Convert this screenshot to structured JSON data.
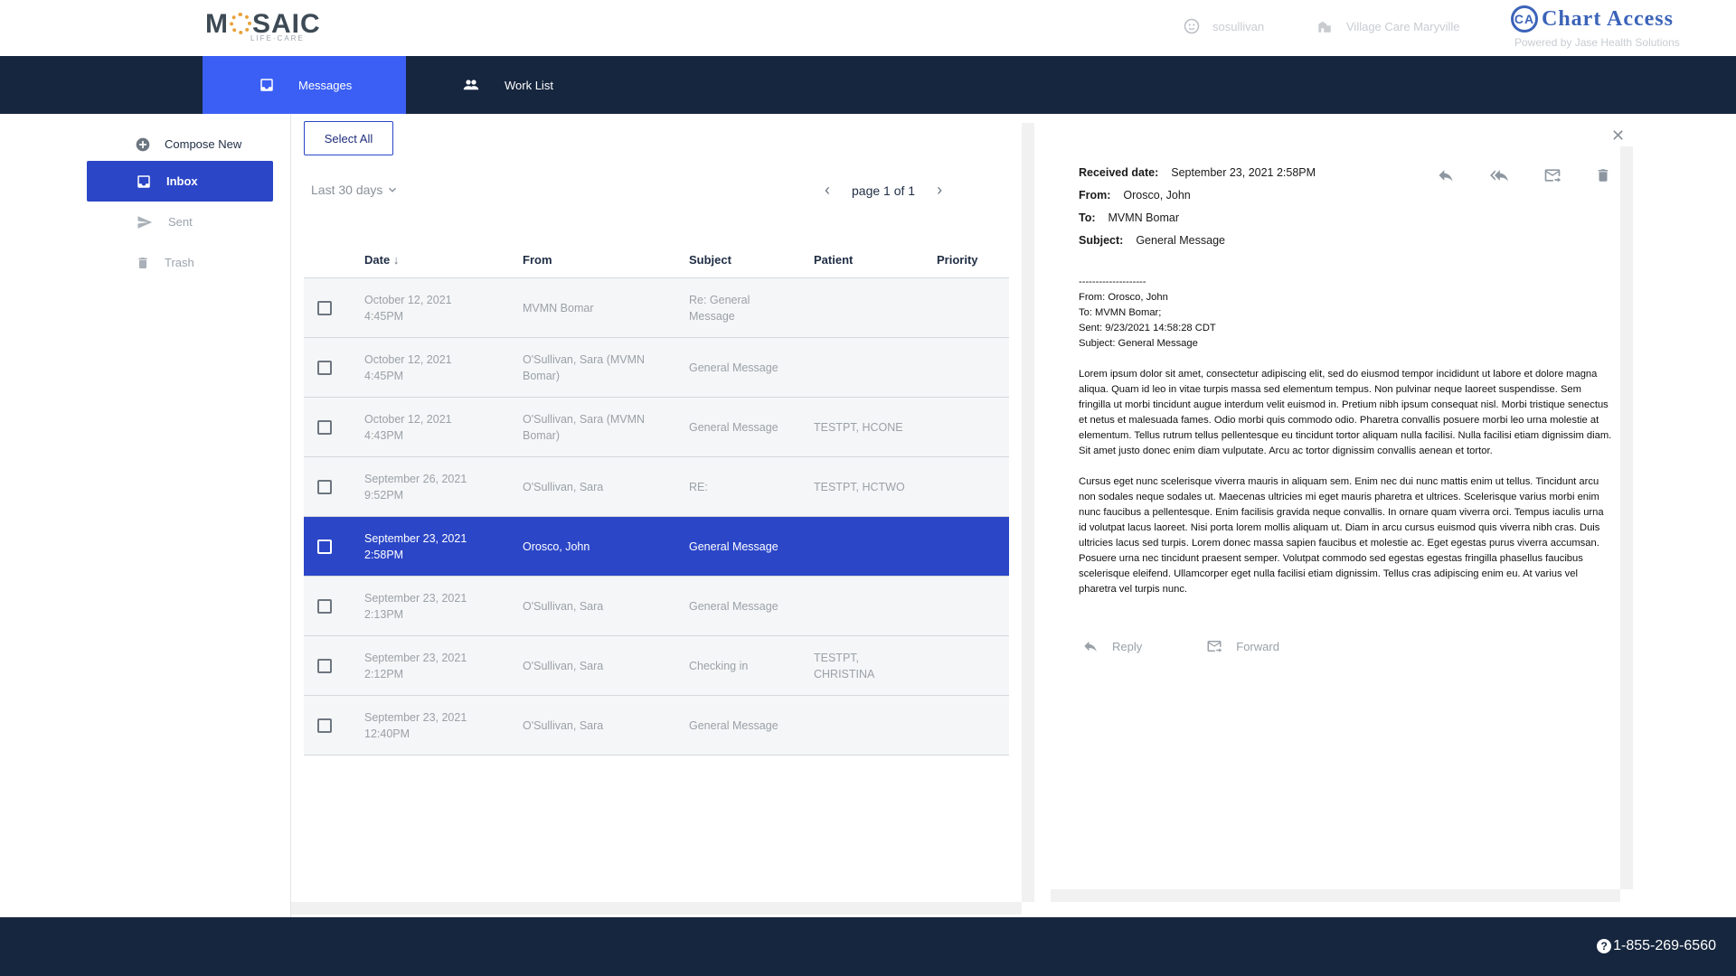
{
  "header": {
    "logo_main": "MOSAIC",
    "logo_sub": "LIFE·CARE",
    "username": "sosullivan",
    "facility": "Village Care Maryville",
    "product": "Chart Access",
    "product_mark": "CA",
    "powered_by": "Powered by Jase Health Solutions"
  },
  "nav": {
    "tabs": [
      {
        "label": "Messages",
        "active": true
      },
      {
        "label": "Work List",
        "active": false
      }
    ]
  },
  "sidebar": {
    "items": [
      {
        "label": "Compose New",
        "icon": "plus-circle-icon"
      },
      {
        "label": "Inbox",
        "icon": "inbox-icon",
        "active": true
      },
      {
        "label": "Sent",
        "icon": "send-icon"
      },
      {
        "label": "Trash",
        "icon": "trash-icon"
      }
    ]
  },
  "list": {
    "select_all": "Select All",
    "range": "Last 30 days",
    "pager": "page 1 of 1",
    "columns": [
      "Date",
      "From",
      "Subject",
      "Patient",
      "Priority"
    ],
    "rows": [
      {
        "date": "October 12, 2021",
        "time": "4:45PM",
        "from": "MVMN Bomar",
        "subject": "Re: General Message",
        "patient": "",
        "priority": ""
      },
      {
        "date": "October 12, 2021",
        "time": "4:45PM",
        "from": "O'Sullivan, Sara (MVMN Bomar)",
        "subject": "General Message",
        "patient": "",
        "priority": ""
      },
      {
        "date": "October 12, 2021",
        "time": "4:43PM",
        "from": "O'Sullivan, Sara (MVMN Bomar)",
        "subject": "General Message",
        "patient": "TESTPT, HCONE",
        "priority": ""
      },
      {
        "date": "September 26, 2021",
        "time": "9:52PM",
        "from": "O'Sullivan, Sara",
        "subject": "RE:",
        "patient": "TESTPT, HCTWO",
        "priority": ""
      },
      {
        "date": "September 23, 2021",
        "time": "2:58PM",
        "from": "Orosco, John",
        "subject": "General Message",
        "patient": "",
        "priority": "",
        "selected": true
      },
      {
        "date": "September 23, 2021",
        "time": "2:13PM",
        "from": "O'Sullivan, Sara",
        "subject": "General Message",
        "patient": "",
        "priority": ""
      },
      {
        "date": "September 23, 2021",
        "time": "2:12PM",
        "from": "O'Sullivan, Sara",
        "subject": "Checking in",
        "patient": "TESTPT, CHRISTINA",
        "priority": ""
      },
      {
        "date": "September 23, 2021",
        "time": "12:40PM",
        "from": "O'Sullivan, Sara",
        "subject": "General Message",
        "patient": "",
        "priority": ""
      }
    ]
  },
  "message": {
    "received_label": "Received date:",
    "received_value": "September 23, 2021 2:58PM",
    "from_label": "From:",
    "from_value": "Orosco, John",
    "to_label": "To:",
    "to_value": "MVMN Bomar",
    "subject_label": "Subject:",
    "subject_value": "General Message",
    "quoted": {
      "divider": "--------------------",
      "from": "From: Orosco, John",
      "to": "To: MVMN Bomar;",
      "sent": "Sent: 9/23/2021 14:58:28 CDT",
      "subject": "Subject: General Message"
    },
    "paragraph1": "Lorem ipsum dolor sit amet, consectetur adipiscing elit, sed do eiusmod tempor incididunt ut labore et dolore magna aliqua. Quam id leo in vitae turpis massa sed elementum tempus. Non pulvinar neque laoreet suspendisse. Sem fringilla ut morbi tincidunt augue interdum velit euismod in. Pretium nibh ipsum consequat nisl. Morbi tristique senectus et netus et malesuada fames. Odio morbi quis commodo odio. Pharetra convallis posuere morbi leo urna molestie at elementum. Tellus rutrum tellus pellentesque eu tincidunt tortor aliquam nulla facilisi. Nulla facilisi etiam dignissim diam. Sit amet justo donec enim diam vulputate. Arcu ac tortor dignissim convallis aenean et tortor.",
    "paragraph2": "Cursus eget nunc scelerisque viverra mauris in aliquam sem. Enim nec dui nunc mattis enim ut tellus. Tincidunt arcu non sodales neque sodales ut. Maecenas ultricies mi eget mauris pharetra et ultrices. Scelerisque varius morbi enim nunc faucibus a pellentesque. Enim facilisis gravida neque convallis. In ornare quam viverra orci. Tempus iaculis urna id volutpat lacus laoreet. Nisi porta lorem mollis aliquam ut. Diam in arcu cursus euismod quis viverra nibh cras. Duis ultricies lacus sed turpis. Lorem donec massa sapien faucibus et molestie ac. Eget egestas purus viverra accumsan. Posuere urna nec tincidunt praesent semper. Volutpat commodo sed egestas egestas fringilla phasellus faucibus scelerisque eleifend. Ullamcorper eget nulla facilisi etiam dignissim. Tellus cras adipiscing enim eu. At varius vel pharetra vel turpis nunc.",
    "reply": "Reply",
    "forward": "Forward"
  },
  "footer": {
    "phone": "1-855-269-6560"
  },
  "colors": {
    "navy": "#16263e",
    "accent_blue": "#3b5ff5",
    "selected_blue": "#2b46c7"
  }
}
